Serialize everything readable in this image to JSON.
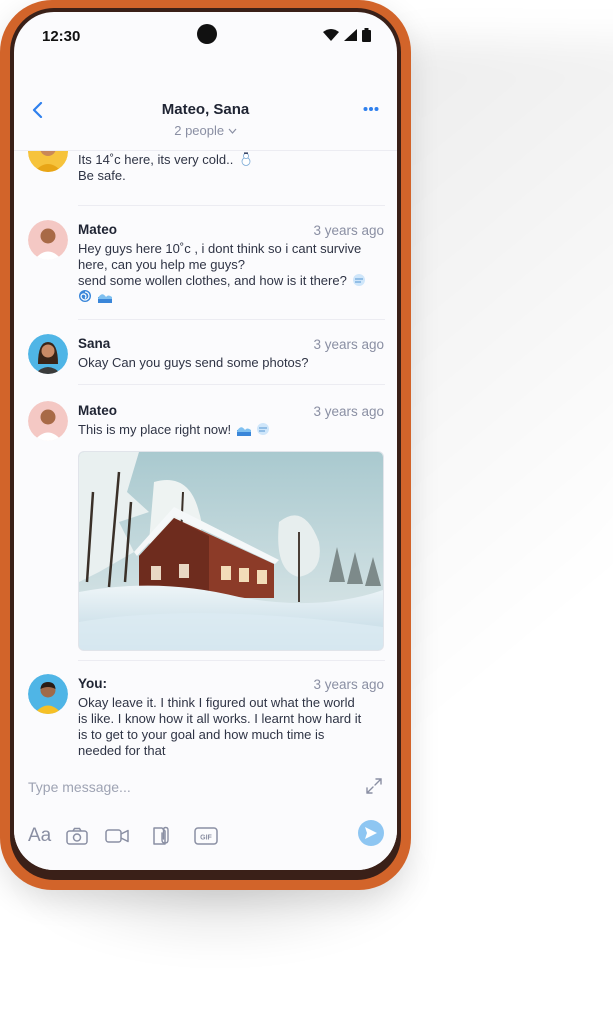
{
  "status_bar": {
    "time": "12:30"
  },
  "header": {
    "title": "Mateo, Sana",
    "subtitle": "2 people",
    "back_icon": "chevron-left-icon",
    "more_icon": "more-horizontal-icon",
    "accent_color": "#2f80ed"
  },
  "messages": [
    {
      "sender": "",
      "time": "",
      "lines": [
        "Its 14˚c here, its very cold..",
        "Be safe."
      ],
      "emoji": [
        "snowman-icon"
      ]
    },
    {
      "sender": "Mateo",
      "time": "3 years ago",
      "lines": [
        "Hey guys here 10˚c , i dont think so i cant survive",
        "here, can you help me guys?",
        "send some wollen clothes, and how is it there?"
      ],
      "emoji": [
        "wind-face-icon",
        "cyclone-icon",
        "wave-icon"
      ]
    },
    {
      "sender": "Sana",
      "time": "3 years ago",
      "lines": [
        "Okay Can you guys send some photos?"
      ]
    },
    {
      "sender": "Mateo",
      "time": "3 years ago",
      "lines": [
        "This is my place right now!"
      ],
      "emoji": [
        "wave-icon",
        "wind-face-icon"
      ],
      "attachment": "snowy-house-photo"
    },
    {
      "sender": "You:",
      "time": "3 years ago",
      "lines": [
        "Okay leave it. I think I figured out what the world",
        "is like. I know how it all works. I learnt how hard it",
        "is to get to your goal and how much time is",
        "needed for that"
      ]
    }
  ],
  "composer": {
    "placeholder": "Type message...",
    "format_label": "Aa",
    "gif_label": "GIF",
    "tools": [
      "text-format-icon",
      "camera-icon",
      "video-icon",
      "attachment-icon",
      "gif-icon"
    ],
    "send_icon": "send-icon",
    "send_color": "#8ec6f2"
  },
  "colors": {
    "frame": "#d2642a",
    "screen": "#fbfbfd",
    "text": "#2f3445",
    "muted": "#8a8fa3"
  }
}
